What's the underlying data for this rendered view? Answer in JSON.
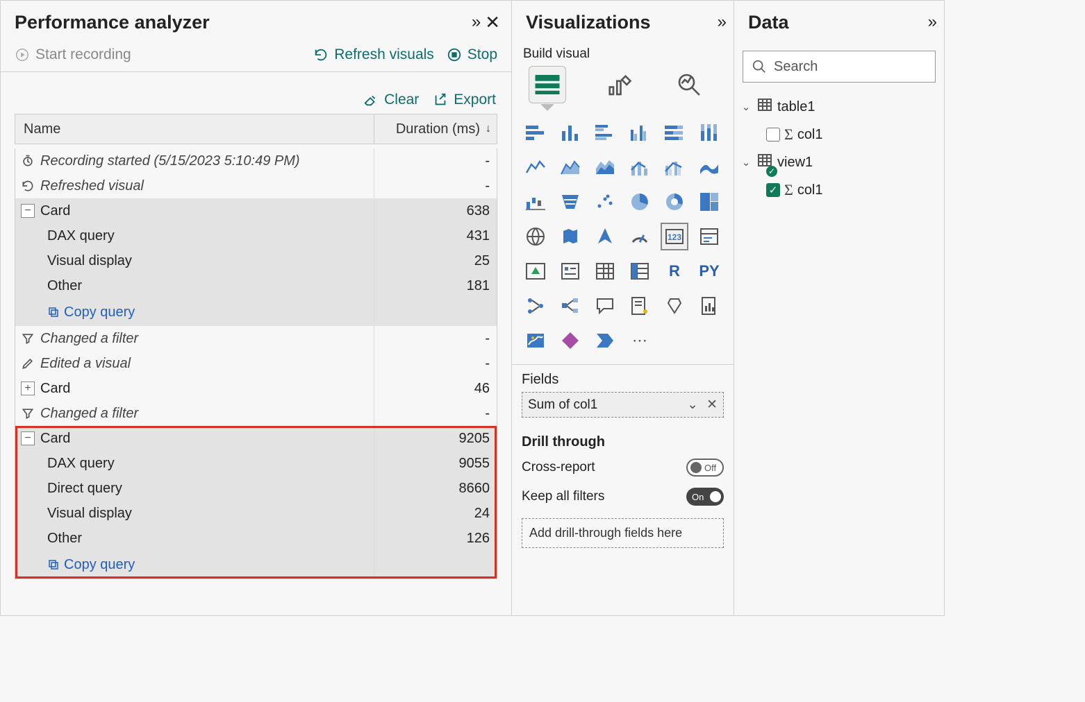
{
  "perf": {
    "title": "Performance analyzer",
    "start": "Start recording",
    "refresh": "Refresh visuals",
    "stop": "Stop",
    "clear": "Clear",
    "export": "Export",
    "col_name": "Name",
    "col_dur": "Duration (ms)",
    "rows": {
      "rec_started": "Recording started (5/15/2023 5:10:49 PM)",
      "refreshed": "Refreshed visual",
      "card1": "Card",
      "card1_dur": "638",
      "dax1": "DAX query",
      "dax1_dur": "431",
      "vis1": "Visual display",
      "vis1_dur": "25",
      "other1": "Other",
      "other1_dur": "181",
      "copy1": "Copy query",
      "chgfilter1": "Changed a filter",
      "edited": "Edited a visual",
      "card2": "Card",
      "card2_dur": "46",
      "chgfilter2": "Changed a filter",
      "card3": "Card",
      "card3_dur": "9205",
      "dax3": "DAX query",
      "dax3_dur": "9055",
      "direct3": "Direct query",
      "direct3_dur": "8660",
      "vis3": "Visual display",
      "vis3_dur": "24",
      "other3": "Other",
      "other3_dur": "126",
      "copy3": "Copy query"
    },
    "dash": "-"
  },
  "viz": {
    "title": "Visualizations",
    "build": "Build visual",
    "fields_label": "Fields",
    "field_pill": "Sum of col1",
    "drill_title": "Drill through",
    "cross_report": "Cross-report",
    "keep_filters": "Keep all filters",
    "toggle_off": "Off",
    "toggle_on": "On",
    "drill_drop": "Add drill-through fields here",
    "r_label": "R",
    "py_label": "PY",
    "ellipsis": "⋯"
  },
  "data": {
    "title": "Data",
    "search_placeholder": "Search",
    "table1": "table1",
    "table1_col": "col1",
    "view1": "view1",
    "view1_col": "col1"
  }
}
